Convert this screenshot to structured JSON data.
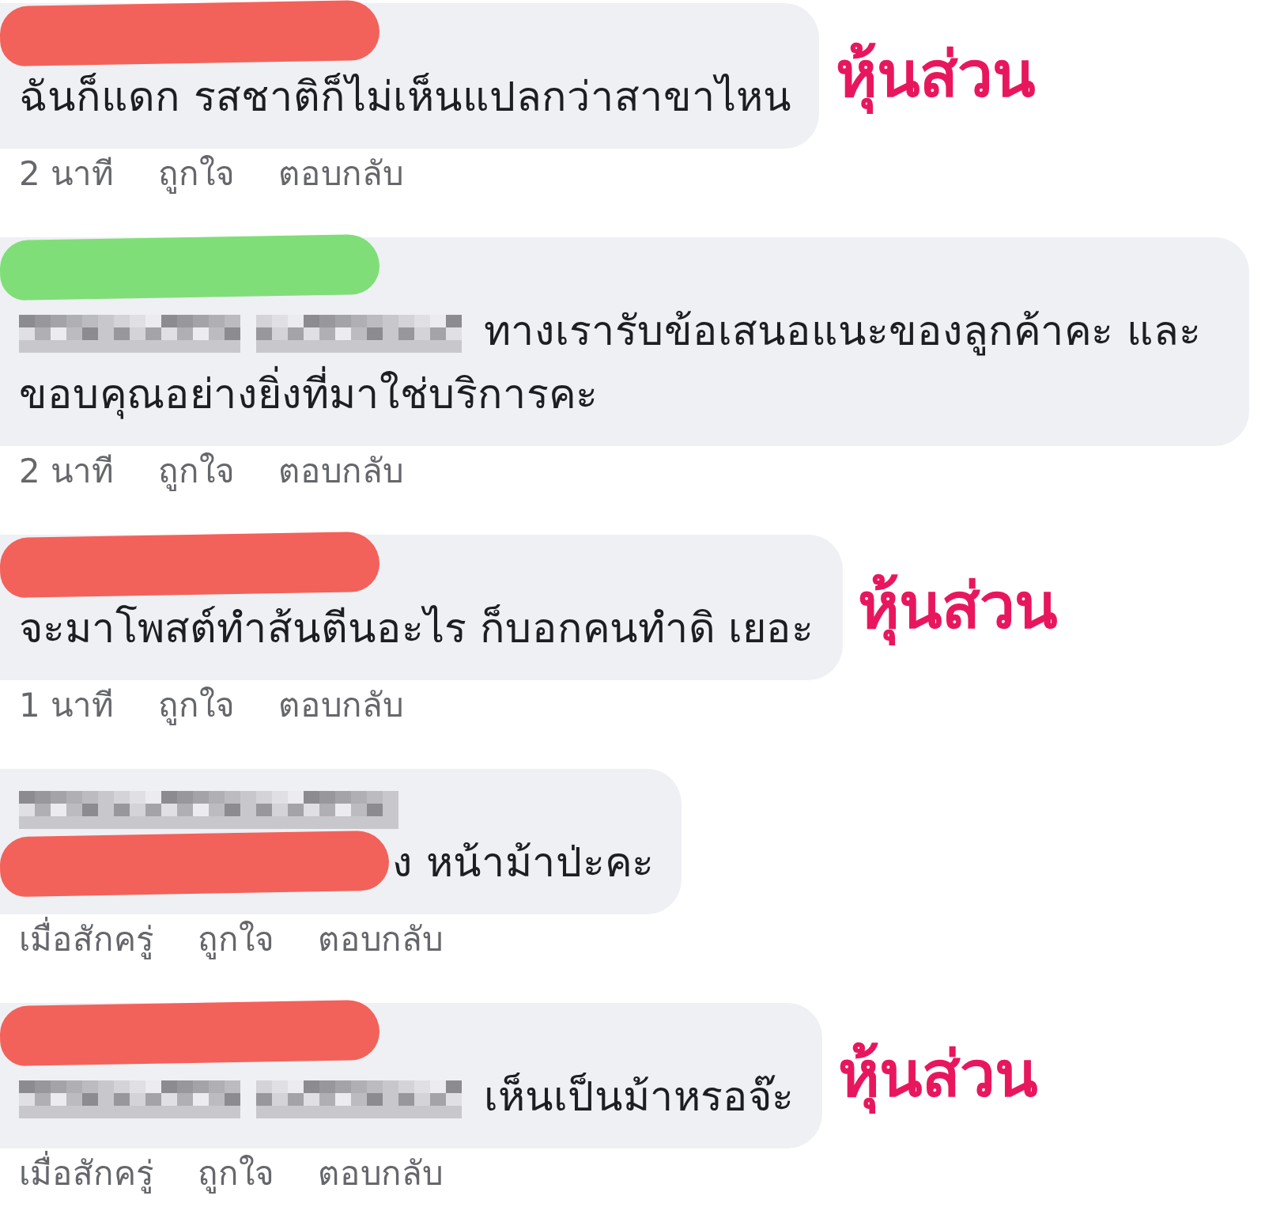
{
  "comments": [
    {
      "scribble": {
        "kind": "name",
        "color": "#f2625a"
      },
      "name_blurred": false,
      "mention_blurred": false,
      "text": "ฉันก็แดก รสชาติก็ไม่เห็นแปลกว่าสาขาไหน",
      "time": "2 นาที",
      "like": "ถูกใจ",
      "reply": "ตอบกลับ",
      "annotation": "หุ้นส่วน"
    },
    {
      "scribble": {
        "kind": "name",
        "color": "#80de78"
      },
      "name_blurred": false,
      "mention_blurred": true,
      "text": "ทางเรารับข้อเสนอแนะของลูกค้าคะ และ ขอบคุณอย่างยิ่งที่มาใช่บริการคะ",
      "time": "2 นาที",
      "like": "ถูกใจ",
      "reply": "ตอบกลับ"
    },
    {
      "scribble": {
        "kind": "name",
        "color": "#f2625a"
      },
      "name_blurred": false,
      "mention_blurred": false,
      "text": "จะมาโพสต์ทำส้นตีนอะไร ก็บอกคนทำดิ เยอะ",
      "time": "1 นาที",
      "like": "ถูกใจ",
      "reply": "ตอบกลับ",
      "annotation": "หุ้นส่วน"
    },
    {
      "scribble": {
        "kind": "text",
        "color": "#f2625a"
      },
      "name_blurred": true,
      "mention_blurred": false,
      "text": "ง หน้าม้าป่ะคะ",
      "time": "เมื่อสักครู่",
      "like": "ถูกใจ",
      "reply": "ตอบกลับ"
    },
    {
      "scribble": {
        "kind": "name",
        "color": "#f2625a"
      },
      "name_blurred": false,
      "mention_blurred": true,
      "text": "เห็นเป็นม้าหรอจ๊ะ",
      "time": "เมื่อสักครู่",
      "like": "ถูกใจ",
      "reply": "ตอบกลับ",
      "annotation": "หุ้นส่วน"
    }
  ]
}
